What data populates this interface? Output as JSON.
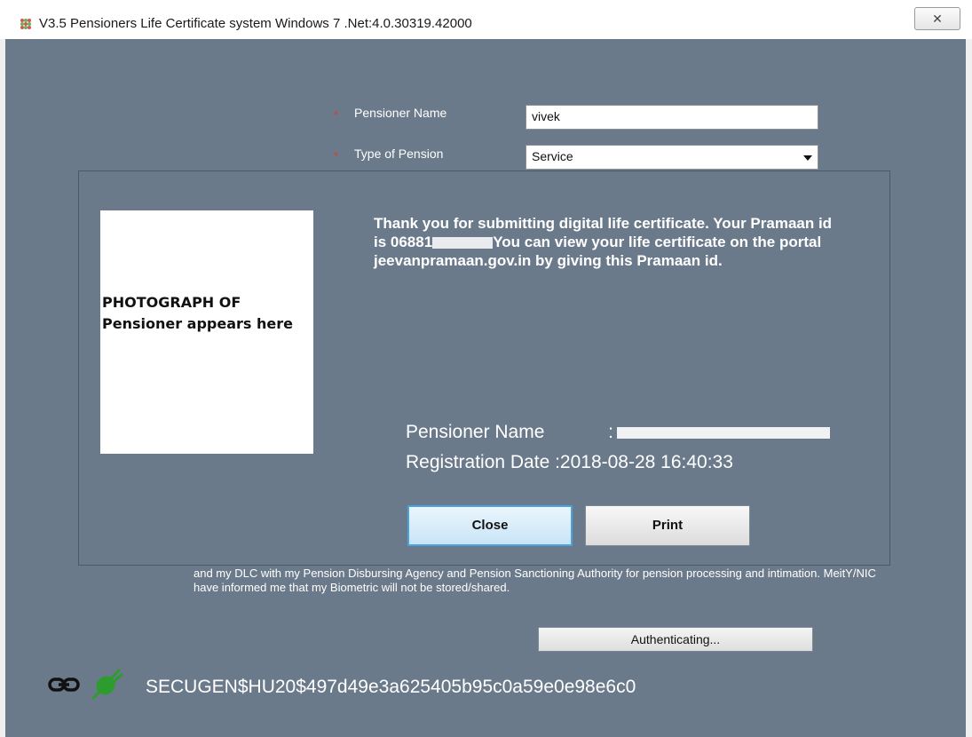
{
  "window": {
    "title": "V3.5 Pensioners Life Certificate system Windows 7 .Net:4.0.30319.42000",
    "close_glyph": "✕",
    "icon": "app-grid-icon"
  },
  "form": {
    "pensioner_name_label": "Pensioner Name",
    "pensioner_name_value": "vivek",
    "pension_type_label": "Type of Pension",
    "pension_type_value": "Service",
    "required_marker": "*"
  },
  "dialog": {
    "photo_placeholder": "PHOTOGRAPH OF Pensioner appears here",
    "message_part1": "Thank you for submitting digital life certificate. Your Pramaan id is 06881",
    "message_part2": "You can view your life certificate on the portal jeevanpramaan.gov.in by giving this Pramaan id.",
    "pensioner_name_label": "Pensioner Name",
    "registration_date_label": "Registration Date :",
    "registration_date_value": "2018-08-28 16:40:33",
    "close_label": "Close",
    "print_label": "Print"
  },
  "consent_text": "and my DLC with my Pension Disbursing Agency and Pension Sanctioning Authority for pension processing and intimation. MeitY/NIC have informed me that my Biometric will not be stored/shared.",
  "status": {
    "authenticating_label": "Authenticating...",
    "device_id": "SECUGEN$HU20$497d49e3a625405b95c0a59e0e98e6c0",
    "link_icon": "chain-link-icon",
    "plug_icon": "green-plug-icon"
  },
  "colors": {
    "client_bg": "#6b7a8b",
    "required_marker": "#e23a2a",
    "connected_plug": "#2e9b2e"
  }
}
